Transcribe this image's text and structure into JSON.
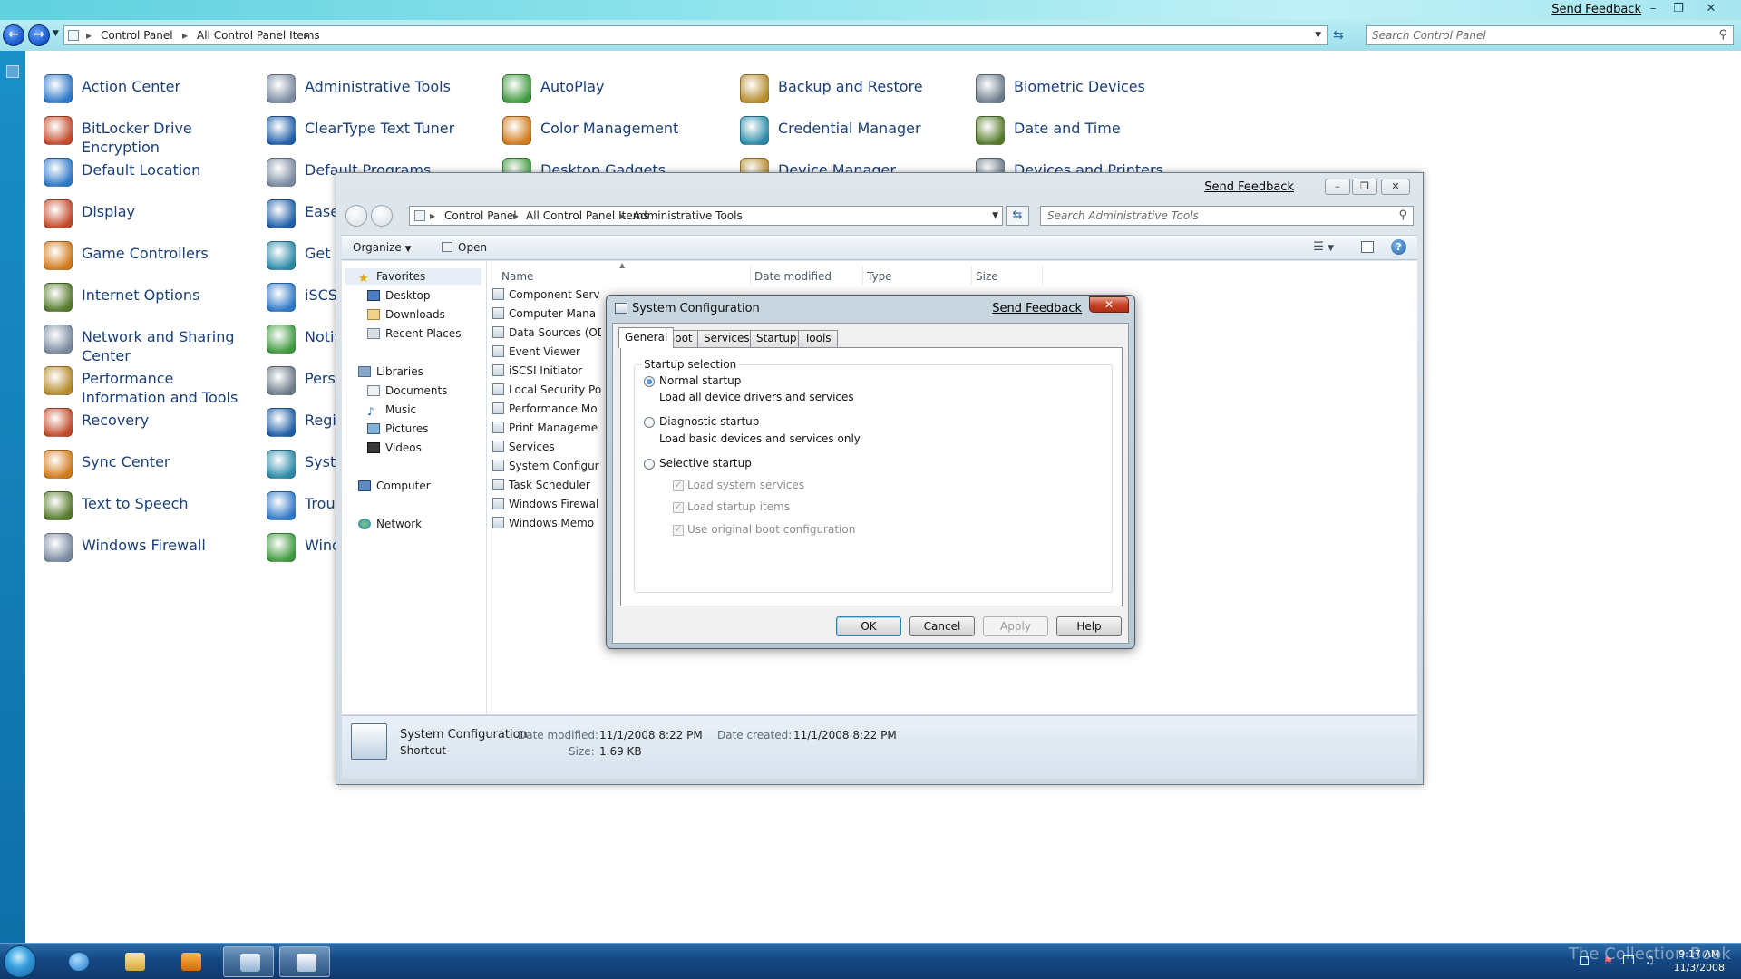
{
  "control_panel": {
    "send_feedback": "Send Feedback",
    "breadcrumb": [
      "Control Panel",
      "All Control Panel Items"
    ],
    "search_placeholder": "Search Control Panel",
    "items": [
      {
        "label": "Action Center",
        "icon": "shield-flag-icon"
      },
      {
        "label": "Administrative Tools",
        "icon": "admin-tools-icon"
      },
      {
        "label": "AutoPlay",
        "icon": "autoplay-icon"
      },
      {
        "label": "Backup and Restore",
        "icon": "backup-icon"
      },
      {
        "label": "Biometric Devices",
        "icon": "fingerprint-icon"
      },
      {
        "label": "BitLocker Drive Encryption",
        "icon": "bitlocker-icon"
      },
      {
        "label": "ClearType Text Tuner",
        "icon": "cleartype-icon"
      },
      {
        "label": "Color Management",
        "icon": "color-management-icon"
      },
      {
        "label": "Credential Manager",
        "icon": "credential-icon"
      },
      {
        "label": "Date and Time",
        "icon": "calendar-clock-icon"
      },
      {
        "label": "Default Location",
        "icon": "house-icon"
      },
      {
        "label": "Default Programs",
        "icon": "default-programs-icon"
      },
      {
        "label": "Desktop Gadgets",
        "icon": "gadgets-icon"
      },
      {
        "label": "Device Manager",
        "icon": "device-manager-icon"
      },
      {
        "label": "Devices and Printers",
        "icon": "printer-icon"
      },
      {
        "label": "Display",
        "icon": "display-icon"
      },
      {
        "label": "Ease",
        "icon": "ease-of-access-icon"
      },
      {
        "label": "Game Controllers",
        "icon": "gamepad-icon"
      },
      {
        "label": "Get F",
        "icon": "get-programs-icon"
      },
      {
        "label": "Internet Options",
        "icon": "globe-icon"
      },
      {
        "label": "iSCSI",
        "icon": "iscsi-icon"
      },
      {
        "label": "Network and Sharing Center",
        "icon": "network-icon"
      },
      {
        "label": "Notifi",
        "icon": "notification-icon"
      },
      {
        "label": "Performance Information and Tools",
        "icon": "performance-icon"
      },
      {
        "label": "Perso",
        "icon": "personalization-icon"
      },
      {
        "label": "Recovery",
        "icon": "recovery-icon"
      },
      {
        "label": "Regio Optio",
        "icon": "region-icon"
      },
      {
        "label": "Sync Center",
        "icon": "sync-icon"
      },
      {
        "label": "Syste",
        "icon": "system-icon"
      },
      {
        "label": "Text to Speech",
        "icon": "speech-icon"
      },
      {
        "label": "Troul",
        "icon": "troubleshoot-icon"
      },
      {
        "label": "Windows Firewall",
        "icon": "firewall-icon"
      },
      {
        "label": "Wind",
        "icon": "windows-update-icon"
      }
    ]
  },
  "admin_tools": {
    "send_feedback": "Send Feedback",
    "breadcrumb": [
      "Control Panel",
      "All Control Panel Items",
      "Administrative Tools"
    ],
    "search_placeholder": "Search Administrative Tools",
    "toolbar": {
      "organize": "Organize",
      "open": "Open"
    },
    "nav": {
      "favorites": "Favorites",
      "favorites_items": [
        "Desktop",
        "Downloads",
        "Recent Places"
      ],
      "libraries": "Libraries",
      "libraries_items": [
        "Documents",
        "Music",
        "Pictures",
        "Videos"
      ],
      "computer": "Computer",
      "network": "Network"
    },
    "columns": [
      "Name",
      "Date modified",
      "Type",
      "Size"
    ],
    "files": [
      "Component Serv",
      "Computer Mana",
      "Data Sources (OD",
      "Event Viewer",
      "iSCSI Initiator",
      "Local Security Po",
      "Performance Mo",
      "Print Manageme",
      "Services",
      "System Configur",
      "Task Scheduler",
      "Windows Firewal",
      "Windows Memo"
    ],
    "details": {
      "name": "System Configuration",
      "type": "Shortcut",
      "date_modified_label": "Date modified:",
      "date_modified": "11/1/2008 8:22 PM",
      "size_label": "Size:",
      "size": "1.69 KB",
      "date_created_label": "Date created:",
      "date_created": "11/1/2008 8:22 PM"
    }
  },
  "system_config": {
    "title": "System Configuration",
    "send_feedback": "Send Feedback",
    "tabs": [
      "General",
      "Boot",
      "Services",
      "Startup",
      "Tools"
    ],
    "active_tab": "General",
    "group_label": "Startup selection",
    "options": [
      {
        "label": "Normal startup",
        "desc": "Load all device drivers and services",
        "selected": true
      },
      {
        "label": "Diagnostic startup",
        "desc": "Load basic devices and services only",
        "selected": false
      },
      {
        "label": "Selective startup",
        "desc": "",
        "selected": false
      }
    ],
    "checkboxes": [
      "Load system services",
      "Load startup items",
      "Use original boot configuration"
    ],
    "buttons": {
      "ok": "OK",
      "cancel": "Cancel",
      "apply": "Apply",
      "help": "Help"
    }
  },
  "taskbar": {
    "clock_time": "9:17 AM",
    "clock_date": "11/3/2008",
    "watermark": "The Collection Book"
  }
}
